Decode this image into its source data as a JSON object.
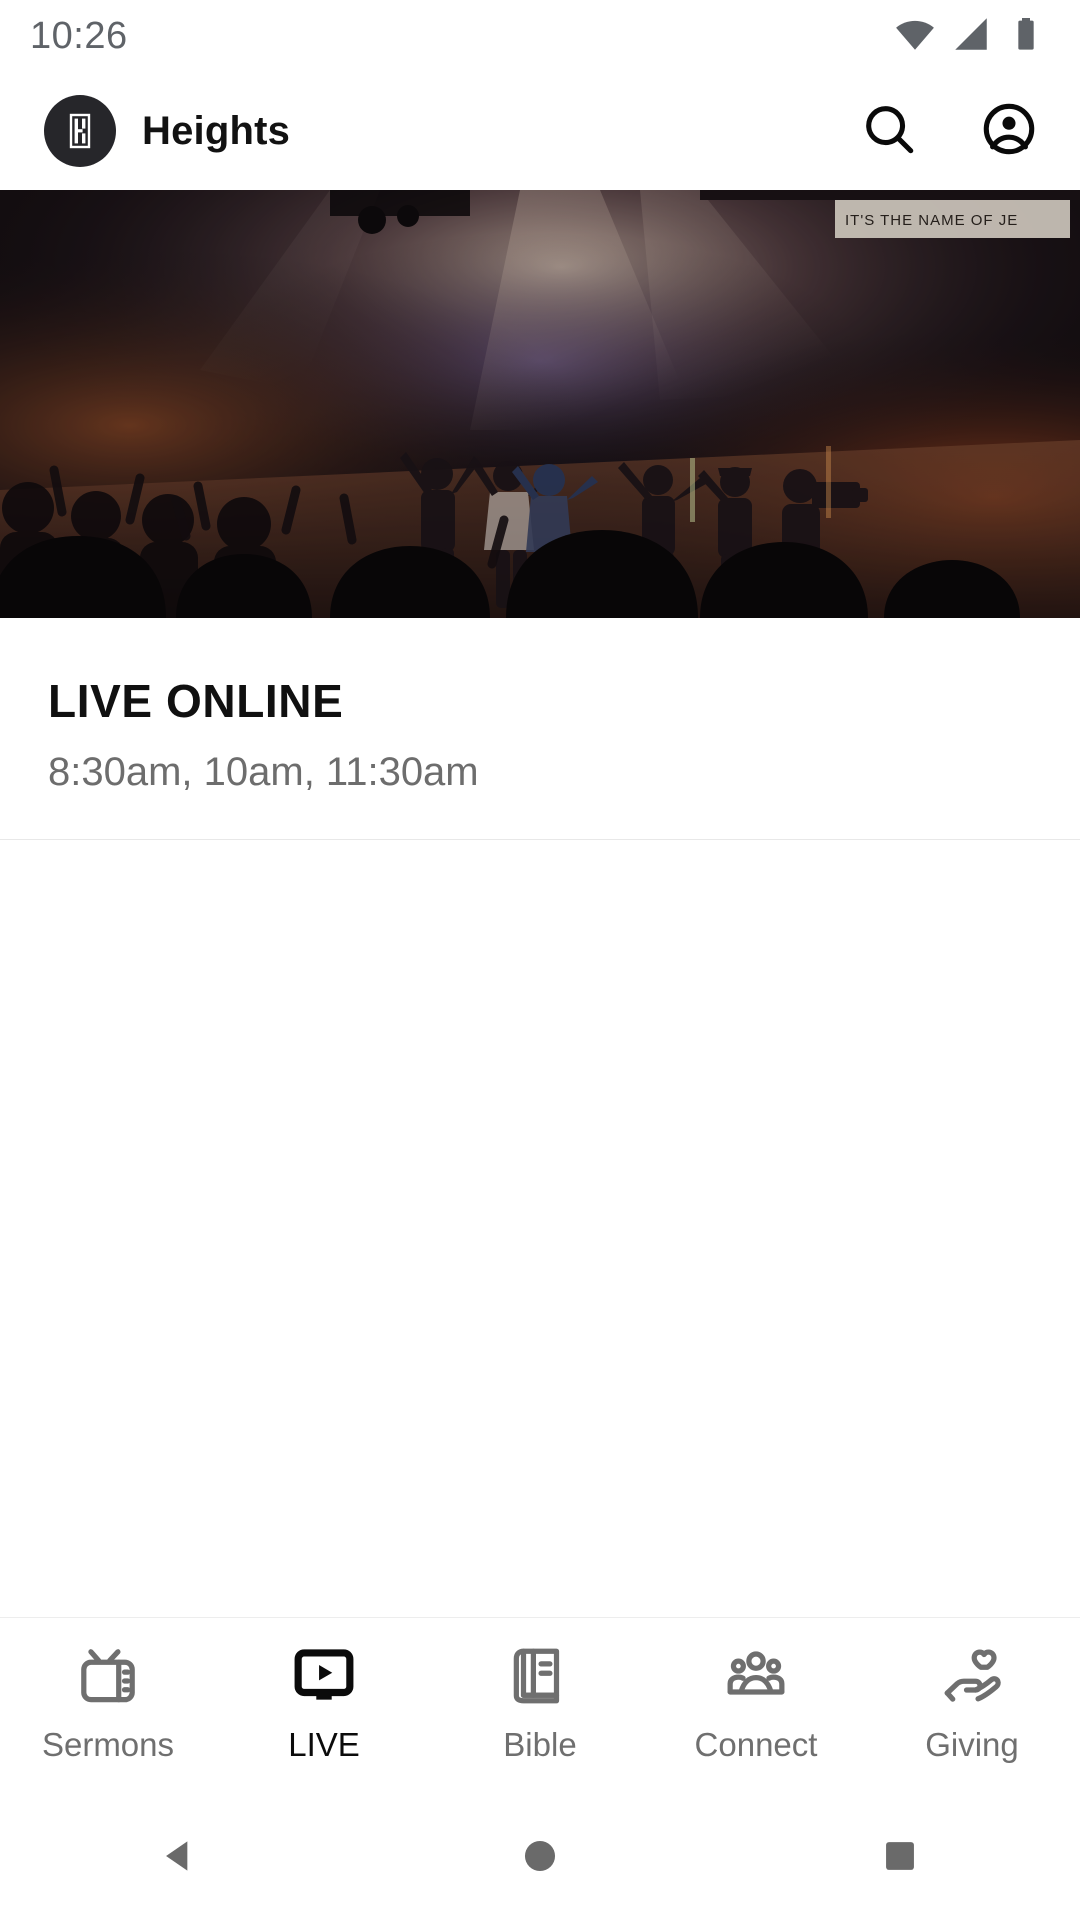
{
  "status_bar": {
    "time": "10:26",
    "icons": [
      "wifi-icon",
      "cellular-signal-icon",
      "battery-icon"
    ],
    "icon_color": "#5f6368"
  },
  "app_bar": {
    "logo_icon": "heights-h-logo-icon",
    "logo_background": "#26262a",
    "title": "Heights",
    "actions": [
      {
        "icon": "search-icon",
        "label": "Search"
      },
      {
        "icon": "account-circle-icon",
        "label": "Account"
      }
    ]
  },
  "hero": {
    "icon": "worship-service-photo",
    "alt": "Worship band on stage with raised hands in a dark auditorium",
    "sign_text": "IT'S THE NAME OF JE",
    "colors": {
      "stage_warm": "#c96a3a",
      "stage_cool": "#5b4e86",
      "backdrop": "#140f14",
      "floor": "#8a5236"
    }
  },
  "live_section": {
    "title": "LIVE ONLINE",
    "times": "8:30am, 10am, 11:30am",
    "title_color": "#101010",
    "times_color": "#6d6d6d"
  },
  "tab_bar": {
    "active_index": 1,
    "active_color": "#0b0b0b",
    "inactive_color": "#6f6f6f",
    "tabs": [
      {
        "label": "Sermons",
        "icon": "retro-tv-icon"
      },
      {
        "label": "LIVE",
        "icon": "monitor-play-icon"
      },
      {
        "label": "Bible",
        "icon": "open-book-icon"
      },
      {
        "label": "Connect",
        "icon": "people-group-icon"
      },
      {
        "label": "Giving",
        "icon": "hand-heart-icon"
      }
    ]
  },
  "system_nav": {
    "buttons": [
      {
        "icon": "back-triangle-icon",
        "label": "Back"
      },
      {
        "icon": "home-circle-icon",
        "label": "Home"
      },
      {
        "icon": "recents-square-icon",
        "label": "Recents"
      }
    ],
    "color": "#6a6a6a"
  }
}
